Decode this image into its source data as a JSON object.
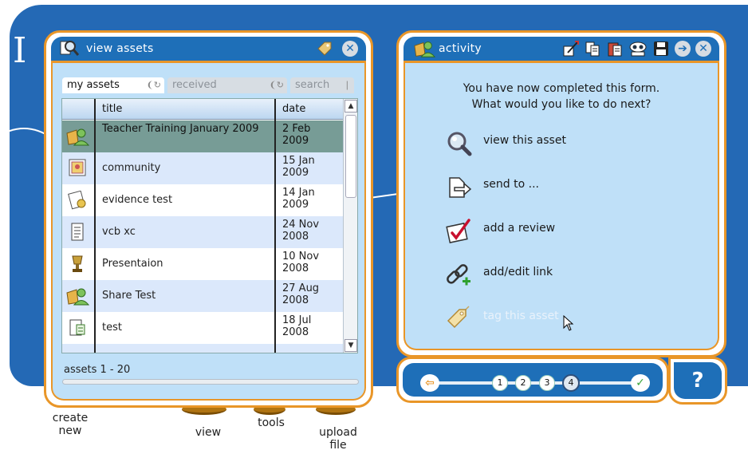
{
  "assets_window": {
    "title": "view assets",
    "tabs": [
      {
        "label": "my assets",
        "active": true
      },
      {
        "label": "received",
        "active": false
      },
      {
        "label": "search",
        "active": false
      }
    ],
    "columns": {
      "title": "title",
      "date": "date"
    },
    "rows": [
      {
        "icon": "people-icon",
        "title": "Teacher Training January 2009",
        "date": "2 Feb 2009",
        "selected": true
      },
      {
        "icon": "photo-icon",
        "title": "community",
        "date": "15 Jan 2009",
        "selected": false
      },
      {
        "icon": "document-badge-icon",
        "title": "evidence test",
        "date": "14 Jan 2009",
        "selected": false
      },
      {
        "icon": "text-document-icon",
        "title": "vcb xc",
        "date": "24 Nov 2008",
        "selected": false
      },
      {
        "icon": "trophy-icon",
        "title": "Presentaion",
        "date": "10 Nov 2008",
        "selected": false
      },
      {
        "icon": "people-icon",
        "title": "Share Test",
        "date": "27 Aug 2008",
        "selected": false
      },
      {
        "icon": "form-icon",
        "title": "test",
        "date": "18 Jul 2008",
        "selected": false
      }
    ],
    "footer": "assets 1 - 20"
  },
  "activity_window": {
    "title": "activity",
    "prompt_line1": "You have now completed this form.",
    "prompt_line2": "What would you like to do next?",
    "actions": [
      {
        "label": "view this asset",
        "icon": "magnifier-icon",
        "enabled": true
      },
      {
        "label": "send to ...",
        "icon": "send-document-icon",
        "enabled": true
      },
      {
        "label": "add a review",
        "icon": "review-check-icon",
        "enabled": true
      },
      {
        "label": "add/edit link",
        "icon": "chain-link-icon",
        "enabled": true
      },
      {
        "label": "tag this asset",
        "icon": "tag-icon",
        "enabled": false
      }
    ],
    "toolbar_icons": [
      "edit-icon",
      "copy-icon",
      "paste-icon",
      "preview-icon",
      "save-icon",
      "forward-icon",
      "close-icon"
    ]
  },
  "stepper": {
    "steps": [
      "1",
      "2",
      "3",
      "4"
    ],
    "current_step": 4
  },
  "help": {
    "label": "?"
  },
  "dock": {
    "create_line1": "create",
    "create_line2": "new",
    "view": "view",
    "tools": "tools",
    "upload_line1": "upload",
    "upload_line2": "file"
  },
  "background_letter": "I",
  "colors": {
    "accent_orange": "#e99628",
    "title_blue": "#1e6fb8",
    "panel_fill": "#bfe0f8",
    "selection": "#779c96",
    "alt_row": "#dbe8fb"
  }
}
